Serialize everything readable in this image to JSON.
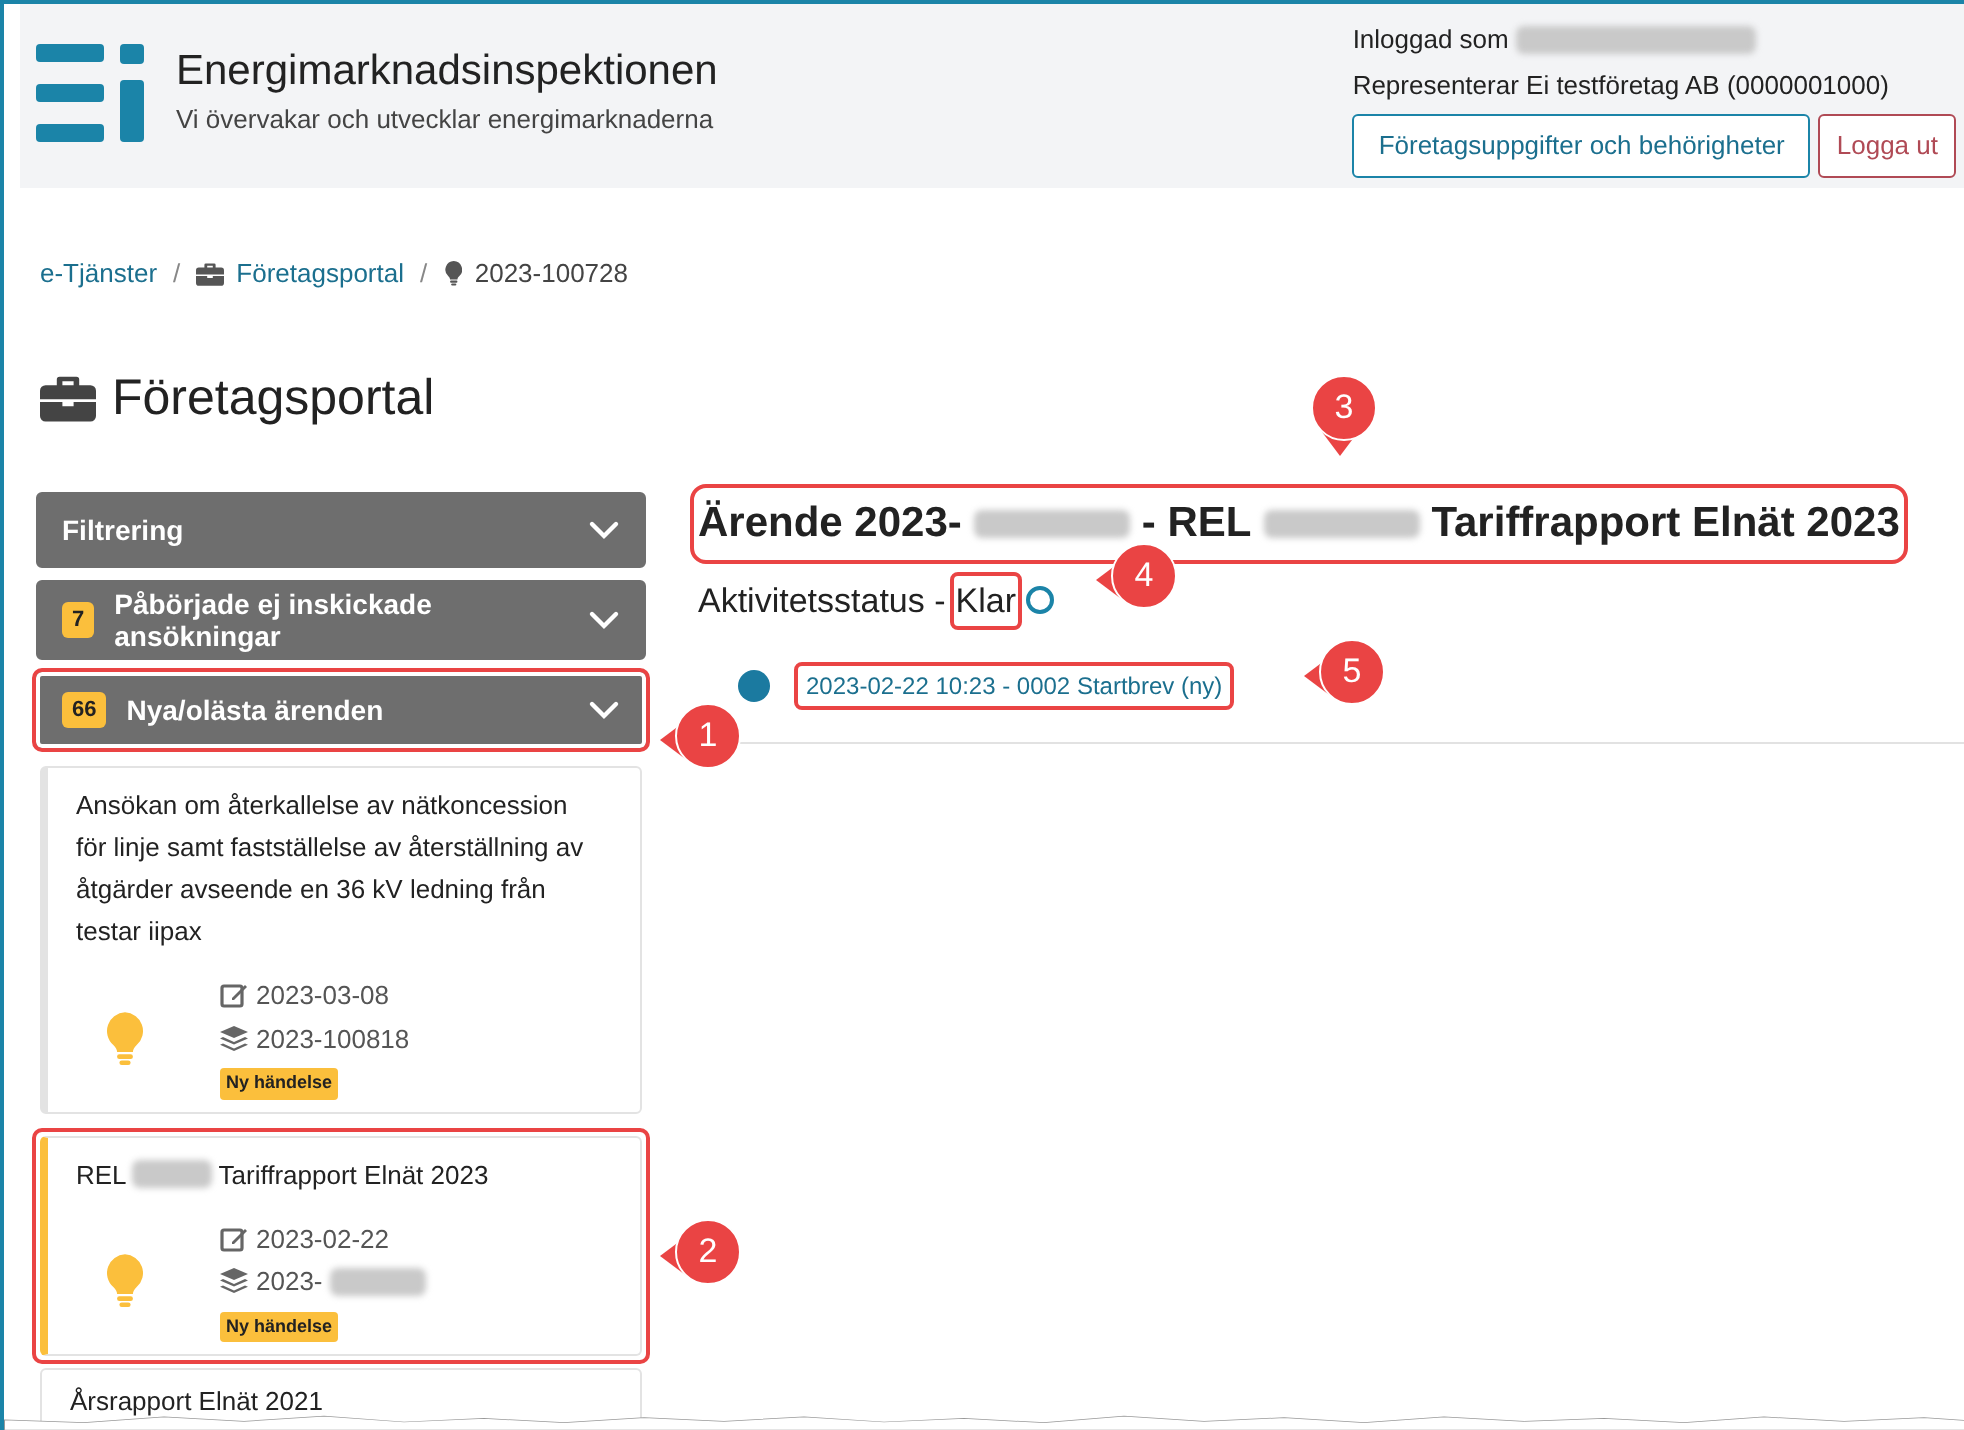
{
  "header": {
    "org_name": "Energimarknadsinspektionen",
    "tagline": "Vi övervakar och utvecklar energimarknaderna",
    "logged_in_label": "Inloggad som",
    "represents": "Representerar Ei testföretag AB (0000001000)",
    "buttons": [
      {
        "label": "Företagsuppgifter och behörigheter",
        "kind": "primary"
      },
      {
        "label": "Logga ut",
        "kind": "danger"
      }
    ]
  },
  "breadcrumb": [
    {
      "label": "e-Tjänster"
    },
    {
      "separator": "/",
      "label": "Företagsportal"
    },
    {
      "separator": "/",
      "label": "2023-100728"
    }
  ],
  "page_title": "Företagsportal",
  "sidebar": {
    "sections": [
      {
        "title": "Filtrering",
        "highlighted": false
      },
      {
        "title": "Påbörjade ej inskickade ansökningar",
        "badge": "7",
        "highlighted": false
      },
      {
        "title": "Nya/olästa ärenden",
        "badge": "66",
        "highlighted": true
      }
    ],
    "cases": [
      {
        "title_parts": [
          "Ansökan om återkallelse av nätkoncession för linje samt fastställelse av återställning av åtgärder avseende en 36 kV ledning från testar iipax"
        ],
        "date": "2023-03-08",
        "case_number": "2023-100818",
        "number_redacted": false,
        "tag": "Ny händelse",
        "selected": false,
        "highlighted": false
      },
      {
        "title_parts": [
          "REL",
          "Tariffrapport Elnät 2023"
        ],
        "date": "2023-02-22",
        "case_number": "2023-",
        "number_redacted": true,
        "tag": "Ny händelse",
        "selected": true,
        "highlighted": true
      }
    ],
    "cut_case_title": "Årsrapport Elnät 2021"
  },
  "main": {
    "title_parts": [
      "Ärende 2023-",
      "- REL",
      "Tariffrapport Elnät 2023"
    ],
    "status_label": "Aktivitetsstatus -",
    "status_value": "Klar",
    "events": [
      {
        "label": "2023-02-22 10:23 - 0002 Startbrev (ny)"
      }
    ]
  },
  "annotations": [
    {
      "number": "1"
    },
    {
      "number": "2"
    },
    {
      "number": "3"
    },
    {
      "number": "4"
    },
    {
      "number": "5"
    }
  ]
}
